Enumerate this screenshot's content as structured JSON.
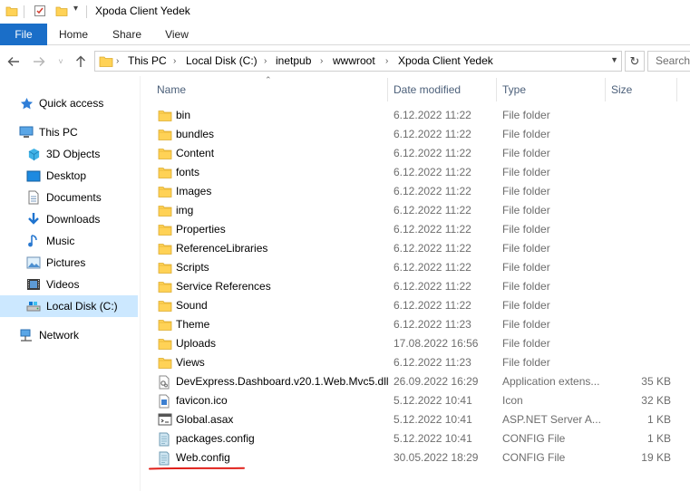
{
  "window": {
    "title": "Xpoda Client Yedek"
  },
  "ribbon": {
    "tabs": [
      "File",
      "Home",
      "Share",
      "View"
    ]
  },
  "address": {
    "crumbs": [
      "This PC",
      "Local Disk (C:)",
      "inetpub",
      "wwwroot",
      "Xpoda Client Yedek"
    ],
    "search_placeholder": "Search Xpoda Client Yedek"
  },
  "nav": {
    "quick_access": "Quick access",
    "this_pc": "This PC",
    "objects_3d": "3D Objects",
    "desktop": "Desktop",
    "documents": "Documents",
    "downloads": "Downloads",
    "music": "Music",
    "pictures": "Pictures",
    "videos": "Videos",
    "local_disk": "Local Disk (C:)",
    "network": "Network"
  },
  "columns": {
    "name": "Name",
    "date": "Date modified",
    "type": "Type",
    "size": "Size"
  },
  "files": [
    {
      "name": "bin",
      "date": "6.12.2022 11:22",
      "type": "File folder",
      "size": "",
      "icon": "folder-icon"
    },
    {
      "name": "bundles",
      "date": "6.12.2022 11:22",
      "type": "File folder",
      "size": "",
      "icon": "folder-icon"
    },
    {
      "name": "Content",
      "date": "6.12.2022 11:22",
      "type": "File folder",
      "size": "",
      "icon": "folder-icon"
    },
    {
      "name": "fonts",
      "date": "6.12.2022 11:22",
      "type": "File folder",
      "size": "",
      "icon": "folder-icon"
    },
    {
      "name": "Images",
      "date": "6.12.2022 11:22",
      "type": "File folder",
      "size": "",
      "icon": "folder-icon"
    },
    {
      "name": "img",
      "date": "6.12.2022 11:22",
      "type": "File folder",
      "size": "",
      "icon": "folder-icon"
    },
    {
      "name": "Properties",
      "date": "6.12.2022 11:22",
      "type": "File folder",
      "size": "",
      "icon": "folder-icon"
    },
    {
      "name": "ReferenceLibraries",
      "date": "6.12.2022 11:22",
      "type": "File folder",
      "size": "",
      "icon": "folder-icon"
    },
    {
      "name": "Scripts",
      "date": "6.12.2022 11:22",
      "type": "File folder",
      "size": "",
      "icon": "folder-icon"
    },
    {
      "name": "Service References",
      "date": "6.12.2022 11:22",
      "type": "File folder",
      "size": "",
      "icon": "folder-icon"
    },
    {
      "name": "Sound",
      "date": "6.12.2022 11:22",
      "type": "File folder",
      "size": "",
      "icon": "folder-icon"
    },
    {
      "name": "Theme",
      "date": "6.12.2022 11:23",
      "type": "File folder",
      "size": "",
      "icon": "folder-icon"
    },
    {
      "name": "Uploads",
      "date": "17.08.2022 16:56",
      "type": "File folder",
      "size": "",
      "icon": "folder-icon"
    },
    {
      "name": "Views",
      "date": "6.12.2022 11:23",
      "type": "File folder",
      "size": "",
      "icon": "folder-icon"
    },
    {
      "name": "DevExpress.Dashboard.v20.1.Web.Mvc5.dll",
      "date": "26.09.2022 16:29",
      "type": "Application extens...",
      "size": "35 KB",
      "icon": "dll-file-icon"
    },
    {
      "name": "favicon.ico",
      "date": "5.12.2022 10:41",
      "type": "Icon",
      "size": "32 KB",
      "icon": "ico-file-icon"
    },
    {
      "name": "Global.asax",
      "date": "5.12.2022 10:41",
      "type": "ASP.NET Server A...",
      "size": "1 KB",
      "icon": "asax-file-icon"
    },
    {
      "name": "packages.config",
      "date": "5.12.2022 10:41",
      "type": "CONFIG File",
      "size": "1 KB",
      "icon": "config-file-icon"
    },
    {
      "name": "Web.config",
      "date": "30.05.2022 18:29",
      "type": "CONFIG File",
      "size": "19 KB",
      "icon": "config-file-icon"
    }
  ],
  "colors": {
    "file_tab": "#1a6ec8",
    "selected_nav": "#cce8ff",
    "folder_yellow": "#ffd256",
    "annotation_red": "#e0201a"
  }
}
